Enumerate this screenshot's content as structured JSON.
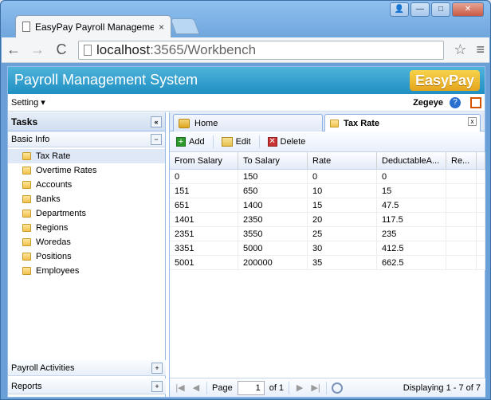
{
  "browser": {
    "tab_title": "EasyPay Payroll Managemen",
    "tab_close": "×",
    "address_host": "localhost",
    "address_rest": ":3565/Workbench",
    "back": "←",
    "forward": "→",
    "reload": "C",
    "star": "☆",
    "menu": "≡",
    "win_user": "👤",
    "win_min": "—",
    "win_max": "□",
    "win_close": "✕"
  },
  "app": {
    "title": "Payroll Management System",
    "logo": "EasyPay",
    "setting_menu": "Setting ▾",
    "user": "Zegeye",
    "help": "?"
  },
  "left_panel": {
    "title": "Tasks",
    "collapse": "«",
    "section_basic": "Basic Info",
    "section_basic_toggle": "−",
    "items": [
      "Tax Rate",
      "Overtime Rates",
      "Accounts",
      "Banks",
      "Departments",
      "Regions",
      "Woredas",
      "Positions",
      "Employees"
    ],
    "section_payroll": "Payroll Activities",
    "section_reports": "Reports",
    "plus": "+"
  },
  "tabs": {
    "home": "Home",
    "tax_rate": "Tax Rate",
    "close": "x"
  },
  "toolbar": {
    "add": "Add",
    "edit": "Edit",
    "delete": "Delete"
  },
  "table": {
    "headers": [
      "From Salary",
      "To Salary",
      "Rate",
      "DeductableA...",
      "Re..."
    ],
    "rows": [
      [
        "0",
        "150",
        "0",
        "0"
      ],
      [
        "151",
        "650",
        "10",
        "15"
      ],
      [
        "651",
        "1400",
        "15",
        "47.5"
      ],
      [
        "1401",
        "2350",
        "20",
        "117.5"
      ],
      [
        "2351",
        "3550",
        "25",
        "235"
      ],
      [
        "3351",
        "5000",
        "30",
        "412.5"
      ],
      [
        "5001",
        "200000",
        "35",
        "662.5"
      ]
    ]
  },
  "pager": {
    "first": "|◀",
    "prev": "◀",
    "page_label": "Page",
    "page_value": "1",
    "of": "of 1",
    "next": "▶",
    "last": "▶|",
    "status": "Displaying 1 - 7 of 7"
  }
}
